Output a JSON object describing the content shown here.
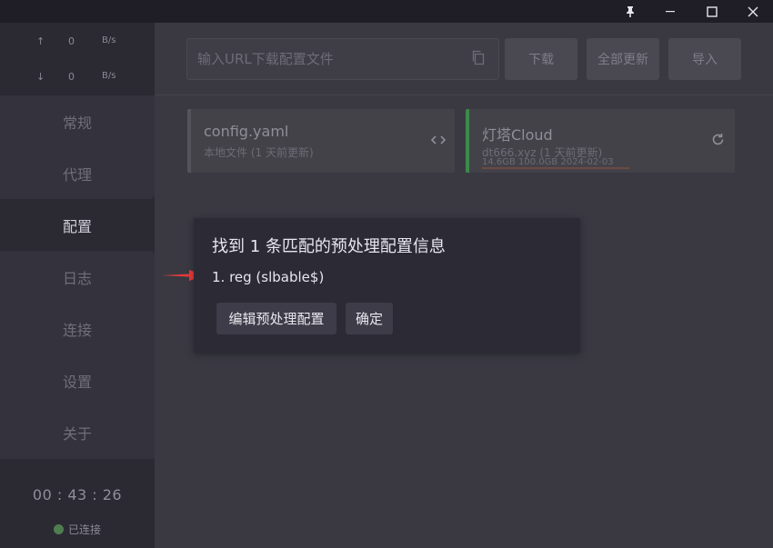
{
  "window": {
    "pin_icon": "pin-icon",
    "minimize_icon": "minimize-icon",
    "maximize_icon": "maximize-icon",
    "close_icon": "close-icon"
  },
  "sidebar": {
    "traffic": {
      "up": {
        "arrow": "↑",
        "value": "0",
        "unit": "B/s"
      },
      "down": {
        "arrow": "↓",
        "value": "0",
        "unit": "B/s"
      }
    },
    "items": [
      {
        "label": "常规"
      },
      {
        "label": "代理"
      },
      {
        "label": "配置"
      },
      {
        "label": "日志"
      },
      {
        "label": "连接"
      },
      {
        "label": "设置"
      },
      {
        "label": "关于"
      }
    ],
    "timer": "00 : 43 : 26",
    "status": "已连接"
  },
  "topbar": {
    "url_placeholder": "输入URL下载配置文件",
    "download_label": "下载",
    "update_all_label": "全部更新",
    "import_label": "导入"
  },
  "profiles": [
    {
      "name": "config.yaml",
      "desc": "本地文件 (1 天前更新)"
    },
    {
      "name": "灯塔Cloud",
      "desc": "dt666.xyz (1 天前更新)",
      "meta": "14.6GB   100.0GB   2024-02-03"
    }
  ],
  "dialog": {
    "title": "找到 1 条匹配的预处理配置信息",
    "item": "1. reg (slbable$)",
    "edit_label": "编辑预处理配置",
    "ok_label": "确定"
  },
  "colors": {
    "accent_green": "#3c8a48",
    "annotation_red": "#e83a3a"
  }
}
